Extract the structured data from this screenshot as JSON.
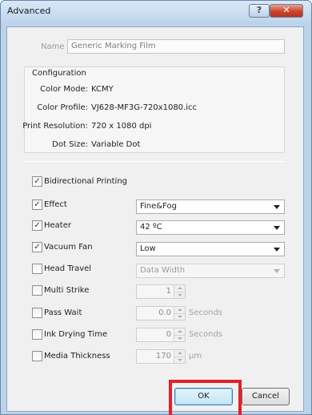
{
  "window": {
    "title": "Advanced",
    "help_glyph": "?",
    "close_glyph": "✕"
  },
  "name": {
    "label": "Name",
    "value": "Generic Marking Film"
  },
  "configuration": {
    "title": "Configuration",
    "color_mode": {
      "label": "Color Mode:",
      "value": "KCMY"
    },
    "color_profile": {
      "label": "Color Profile:",
      "value": "VJ628-MF3G-720x1080.icc"
    },
    "print_resolution": {
      "label": "Print Resolution:",
      "value": "720 x 1080 dpi"
    },
    "dot_size": {
      "label": "Dot Size:",
      "value": "Variable Dot"
    }
  },
  "options": {
    "bidirectional": {
      "label": "Bidirectional Printing",
      "checked": true
    },
    "effect": {
      "label": "Effect",
      "checked": true,
      "value": "Fine&Fog"
    },
    "heater": {
      "label": "Heater",
      "checked": true,
      "value": "42 ºC"
    },
    "vacuum_fan": {
      "label": "Vacuum Fan",
      "checked": true,
      "value": "Low"
    },
    "head_travel": {
      "label": "Head Travel",
      "checked": false,
      "value": "Data Width"
    },
    "multi_strike": {
      "label": "Multi Strike",
      "checked": false,
      "value": "1"
    },
    "pass_wait": {
      "label": "Pass Wait",
      "checked": false,
      "value": "0.0",
      "unit": "Seconds"
    },
    "ink_drying": {
      "label": "Ink Drying Time",
      "checked": false,
      "value": "0",
      "unit": "Seconds"
    },
    "media_thickness": {
      "label": "Media Thickness",
      "checked": false,
      "value": "170",
      "unit": "µm"
    }
  },
  "buttons": {
    "ok": "OK",
    "cancel": "Cancel"
  },
  "colors": {
    "highlight": "#e0212b",
    "window_frame": "#bcd3ea",
    "dialog_bg": "#f0f0f0"
  }
}
